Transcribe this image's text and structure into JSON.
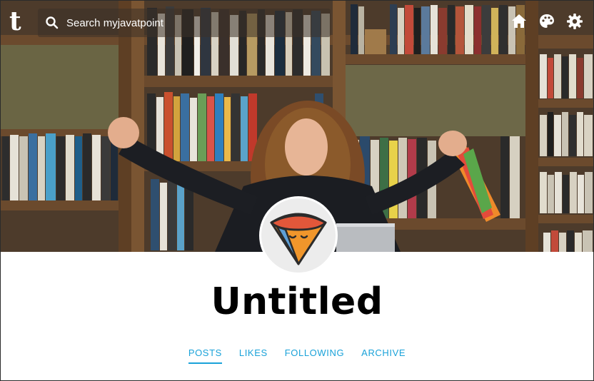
{
  "app": {
    "logo_letter": "t"
  },
  "search": {
    "placeholder": "Search myjavatpoint"
  },
  "nav_icons": [
    "home-icon",
    "palette-icon",
    "gear-icon"
  ],
  "blog": {
    "title": "Untitled"
  },
  "tabs": [
    {
      "label": "POSTS",
      "active": true
    },
    {
      "label": "LIKES",
      "active": false
    },
    {
      "label": "FOLLOWING",
      "active": false
    },
    {
      "label": "ARCHIVE",
      "active": false
    }
  ],
  "colors": {
    "accent": "#1aa2d9",
    "title": "#000000",
    "avatar_bg": "#ececec"
  }
}
